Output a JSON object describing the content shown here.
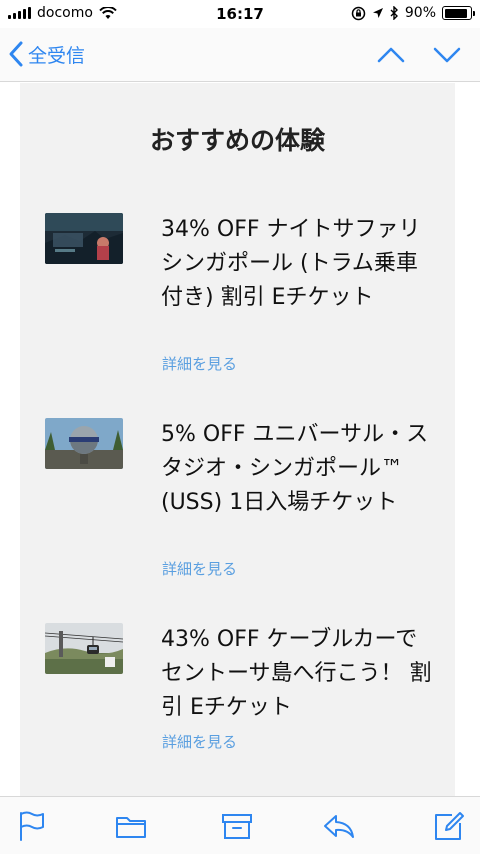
{
  "status_bar": {
    "carrier": "docomo",
    "time": "16:17",
    "battery_percent": "90%",
    "battery_level": 0.9
  },
  "nav": {
    "back_label": "全受信"
  },
  "content": {
    "section_title": "おすすめの体験",
    "items": [
      {
        "title": "34% OFF ナイトサファリ シンガポール (トラム乗車付き) 割引 Eチケット",
        "link": "詳細を見る",
        "image": "night-safari-photo"
      },
      {
        "title": "5% OFF ユニバーサル・スタジオ・シンガポール™ (USS) 1日入場チケット",
        "link": "詳細を見る",
        "image": "universal-studios-globe-photo"
      },
      {
        "title": "43% OFF ケーブルカーでセントーサ島へ行こう！ 割引 Eチケット",
        "link": "詳細を見る",
        "image": "cable-car-photo"
      }
    ]
  },
  "toolbar": {
    "icons": [
      "flag-icon",
      "folder-icon",
      "archive-icon",
      "reply-icon",
      "compose-icon"
    ],
    "accent_color": "#2e86f0"
  },
  "colors": {
    "accent": "#2e86f0",
    "link": "#5a9fe0",
    "content_bg": "#f2f2f2"
  }
}
